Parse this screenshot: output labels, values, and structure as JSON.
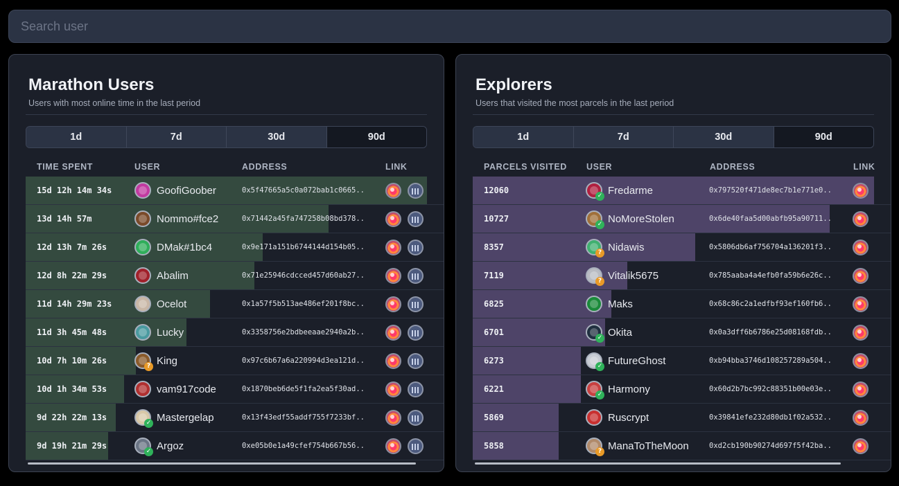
{
  "search": {
    "placeholder": "Search user"
  },
  "marathon": {
    "title": "Marathon Users",
    "subtitle": "Users with most online time in the last period",
    "tabs": [
      "1d",
      "7d",
      "30d",
      "90d"
    ],
    "active_tab": "90d",
    "columns": [
      "TIME SPENT",
      "USER",
      "ADDRESS",
      "LINK"
    ],
    "rows": [
      {
        "value": "15d 12h 14m 34s",
        "fill": 1.0,
        "user": "GoofiGoober",
        "avatar": "#c13aa0",
        "badge": "",
        "address": "0x5f47665a5c0a072bab1c0665.."
      },
      {
        "value": "13d 14h 57m",
        "fill": 0.755,
        "user": "Nommo#fce2",
        "avatar": "#7a4a2a",
        "badge": "",
        "address": "0x71442a45fa747258b08bd378.."
      },
      {
        "value": "12d 13h 7m 26s",
        "fill": 0.59,
        "user": "DMak#1bc4",
        "avatar": "#2fae5a",
        "badge": "",
        "address": "0x9e171a151b6744144d154b05.."
      },
      {
        "value": "12d 8h 22m 29s",
        "fill": 0.57,
        "user": "Abalim",
        "avatar": "#a0202a",
        "badge": "",
        "address": "0x71e25946cdcced457d60ab27.."
      },
      {
        "value": "11d 14h 29m 23s",
        "fill": 0.46,
        "user": "Ocelot",
        "avatar": "#c9b7a6",
        "badge": "",
        "address": "0x1a57f5b513ae486ef201f8bc.."
      },
      {
        "value": "11d 3h 45m 48s",
        "fill": 0.4,
        "user": "Lucky",
        "avatar": "#4a9aa0",
        "badge": "",
        "address": "0x3358756e2bdbeeaae2940a2b.."
      },
      {
        "value": "10d 7h 10m 26s",
        "fill": 0.275,
        "user": "King",
        "avatar": "#8a5a2a",
        "badge": "?",
        "address": "0x97c6b67a6a220994d3ea121d.."
      },
      {
        "value": "10d 1h 34m 53s",
        "fill": 0.245,
        "user": "vam917code",
        "avatar": "#b03030",
        "badge": "",
        "address": "0x1870beb6de5f1fa2ea5f30ad.."
      },
      {
        "value": "9d 22h 22m 13s",
        "fill": 0.225,
        "user": "Mastergelap",
        "avatar": "#d8c8a8",
        "badge": "ok",
        "address": "0x13f43edf55addf755f7233bf.."
      },
      {
        "value": "9d 19h 21m 29s",
        "fill": 0.205,
        "user": "Argoz",
        "avatar": "#6a7484",
        "badge": "ok",
        "address": "0xe05b0e1a49cfef754b667b56.."
      }
    ]
  },
  "explorers": {
    "title": "Explorers",
    "subtitle": "Users that visited the most parcels in the last period",
    "tabs": [
      "1d",
      "7d",
      "30d",
      "90d"
    ],
    "active_tab": "90d",
    "columns": [
      "PARCELS VISITED",
      "USER",
      "ADDRESS",
      "LINK"
    ],
    "rows": [
      {
        "value": "12060",
        "fill": 1.0,
        "user": "Fredarme",
        "avatar": "#b02040",
        "badge": "ok",
        "address": "0x797520f471de8ec7b1e771e0.."
      },
      {
        "value": "10727",
        "fill": 0.89,
        "user": "NoMoreStolen",
        "avatar": "#a0703a",
        "badge": "ok",
        "address": "0x6de40faa5d00abfb95a90711.."
      },
      {
        "value": "8357",
        "fill": 0.555,
        "user": "Nidawis",
        "avatar": "#40b070",
        "badge": "?",
        "address": "0x5806db6af756704a136201f3.."
      },
      {
        "value": "7119",
        "fill": 0.385,
        "user": "Vitalik5675",
        "avatar": "#b9bcc3",
        "badge": "?",
        "address": "0x785aaba4a4efb0fa59b6e26c.."
      },
      {
        "value": "6825",
        "fill": 0.345,
        "user": "Maks",
        "avatar": "#1a8a3a",
        "badge": "",
        "address": "0x68c86c2a1edfbf93ef160fb6.."
      },
      {
        "value": "6701",
        "fill": 0.33,
        "user": "Okita",
        "avatar": "#203040",
        "badge": "ok",
        "address": "0x0a3dff6b6786e25d08168fdb.."
      },
      {
        "value": "6273",
        "fill": 0.27,
        "user": "FutureGhost",
        "avatar": "#c8ccd4",
        "badge": "ok",
        "address": "0xb94bba3746d108257289a504.."
      },
      {
        "value": "6221",
        "fill": 0.27,
        "user": "Harmony",
        "avatar": "#c84040",
        "badge": "ok",
        "address": "0x60d2b7bc992c88351b00e03e.."
      },
      {
        "value": "5869",
        "fill": 0.215,
        "user": "Ruscrypt",
        "avatar": "#c83030",
        "badge": "",
        "address": "0x39841efe232d80db1f02a532.."
      },
      {
        "value": "5858",
        "fill": 0.215,
        "user": "ManaToTheMoon",
        "avatar": "#b08a6a",
        "badge": "?",
        "address": "0xd2cb190b90274d697f5f42ba.."
      }
    ]
  },
  "icons": {
    "link_1": "decentraland-icon",
    "link_2": "stats-icon"
  }
}
